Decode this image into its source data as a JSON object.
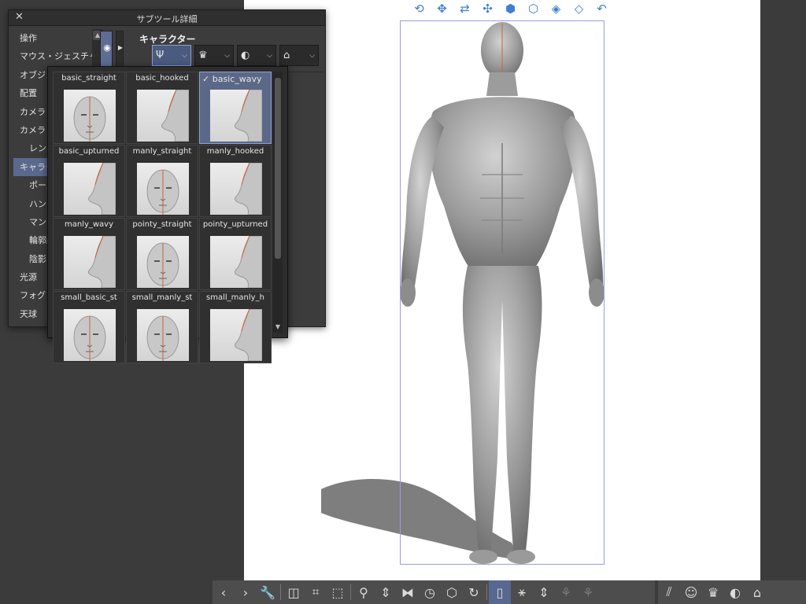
{
  "panel": {
    "close_icon": "close-icon",
    "title": "サブツール詳細"
  },
  "categories": [
    {
      "label": "操作",
      "sub": false,
      "active": false
    },
    {
      "label": "マウス・ジェスチャー",
      "sub": false,
      "active": false
    },
    {
      "label": "オブジェクト",
      "sub": false,
      "active": false
    },
    {
      "label": "配置",
      "sub": false,
      "active": false
    },
    {
      "label": "カメラ",
      "sub": false,
      "active": false
    },
    {
      "label": "カメラ",
      "sub": false,
      "active": false
    },
    {
      "label": "レンズ",
      "sub": true,
      "active": false
    },
    {
      "label": "キャラクター",
      "sub": false,
      "active": true
    },
    {
      "label": "ポーズ",
      "sub": true,
      "active": false
    },
    {
      "label": "ハンド",
      "sub": true,
      "active": false
    },
    {
      "label": "マンガ",
      "sub": true,
      "active": false
    },
    {
      "label": "輪郭線",
      "sub": true,
      "active": false
    },
    {
      "label": "陰影",
      "sub": true,
      "active": false
    },
    {
      "label": "光源",
      "sub": false,
      "active": false
    },
    {
      "label": "フォグ",
      "sub": false,
      "active": false
    },
    {
      "label": "天球",
      "sub": false,
      "active": false
    }
  ],
  "section": {
    "title": "キャラクター",
    "parts": [
      {
        "icon": "nose-icon",
        "selected": true
      },
      {
        "icon": "hair-icon",
        "selected": false
      },
      {
        "icon": "ear-icon",
        "selected": false
      },
      {
        "icon": "accessory-icon",
        "selected": false
      }
    ]
  },
  "nose_popup": {
    "checkmark": "✓",
    "items": [
      {
        "label": "basic_straight",
        "view": "front",
        "selected": false
      },
      {
        "label": "basic_hooked",
        "view": "side",
        "selected": false
      },
      {
        "label": "basic_wavy",
        "view": "side",
        "selected": true
      },
      {
        "label": "basic_upturned",
        "view": "side",
        "selected": false
      },
      {
        "label": "manly_straight",
        "view": "front",
        "selected": false
      },
      {
        "label": "manly_hooked",
        "view": "side",
        "selected": false
      },
      {
        "label": "manly_wavy",
        "view": "side",
        "selected": false
      },
      {
        "label": "pointy_straight",
        "view": "front",
        "selected": false
      },
      {
        "label": "pointy_upturned",
        "view": "side",
        "selected": false
      },
      {
        "label": "small_basic_st",
        "view": "front",
        "selected": false
      },
      {
        "label": "small_manly_st",
        "view": "front",
        "selected": false
      },
      {
        "label": "small_manly_h",
        "view": "side",
        "selected": false
      }
    ]
  },
  "manipulators": [
    "camera-rotate-icon",
    "camera-pan-icon",
    "camera-move-icon",
    "object-move-icon",
    "object-rotate-x-icon",
    "object-rotate-y-icon",
    "object-rotate-z-icon",
    "object-rotate-free-icon",
    "undo-pose-icon"
  ],
  "toolbar": {
    "left_items": [
      {
        "name": "prev-icon",
        "glyph": "‹",
        "state": "normal"
      },
      {
        "name": "next-icon",
        "glyph": "›",
        "state": "normal"
      },
      {
        "name": "wrench-icon",
        "glyph": "🔧",
        "state": "normal"
      },
      {
        "sep": true
      },
      {
        "name": "camera-icon",
        "glyph": "◫",
        "state": "normal"
      },
      {
        "name": "fit-icon",
        "glyph": "⌗",
        "state": "normal"
      },
      {
        "name": "ground-icon",
        "glyph": "⬚",
        "state": "normal"
      },
      {
        "sep": true
      },
      {
        "name": "pose-icon",
        "glyph": "⚲",
        "state": "normal"
      },
      {
        "name": "updown-icon",
        "glyph": "⇕",
        "state": "normal"
      },
      {
        "name": "flip-icon",
        "glyph": "⧓",
        "state": "normal"
      },
      {
        "name": "timer-icon",
        "glyph": "◷",
        "state": "normal"
      },
      {
        "name": "object-reset-icon",
        "glyph": "⬡",
        "state": "normal"
      },
      {
        "name": "rotate-reset-icon",
        "glyph": "↻",
        "state": "normal"
      },
      {
        "sep": true
      },
      {
        "name": "frame-icon",
        "glyph": "▯",
        "state": "active"
      },
      {
        "name": "body-shape-icon",
        "glyph": "⚹",
        "state": "normal"
      },
      {
        "name": "updown2-icon",
        "glyph": "⇕",
        "state": "normal"
      },
      {
        "name": "lock-pose-icon",
        "glyph": "⚘",
        "state": "dim"
      },
      {
        "name": "unlock-pose-icon",
        "glyph": "⚘",
        "state": "dim"
      }
    ],
    "right_items": [
      {
        "name": "nose-part-icon",
        "glyph": "⫽"
      },
      {
        "name": "face-icon",
        "glyph": "☺"
      },
      {
        "name": "hair-part-icon",
        "glyph": "♛"
      },
      {
        "name": "ear-part-icon",
        "glyph": "◐"
      },
      {
        "name": "accessory-part-icon",
        "glyph": "⌂"
      }
    ]
  },
  "colors": {
    "accent": "#5a6a8e",
    "panel_bg": "#3c3c3c",
    "canvas_bg": "#ffffff",
    "bbox": "#9a9ae6"
  }
}
